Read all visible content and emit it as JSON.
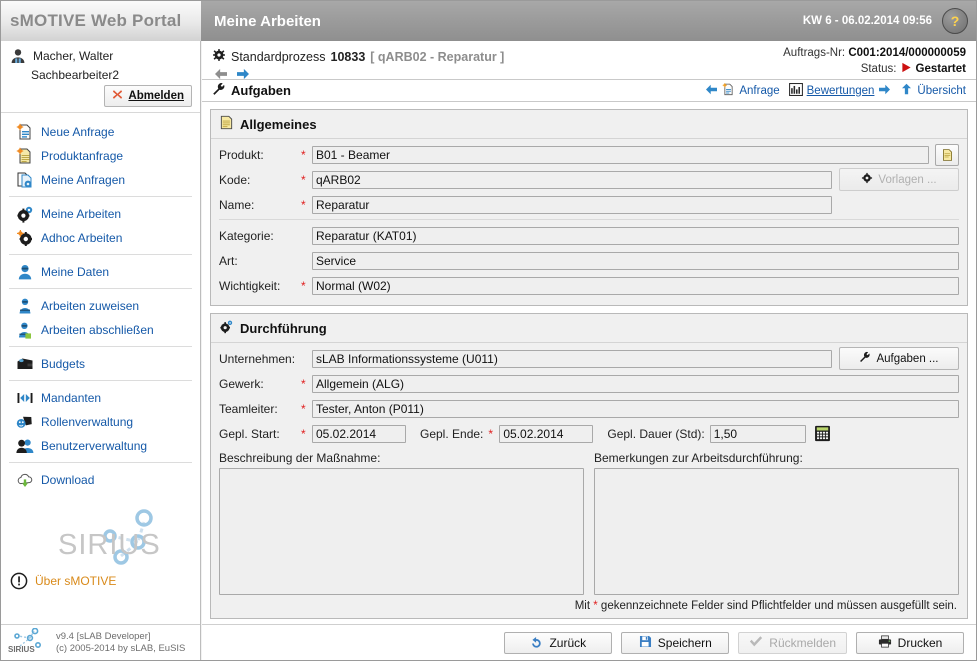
{
  "app": {
    "brand": "sMOTIVE Web Portal",
    "page_title": "Meine Arbeiten",
    "kw_datetime": "KW 6 - 06.02.2014 09:56",
    "help_label": "?"
  },
  "user": {
    "name": "Macher, Walter",
    "role": "Sachbearbeiter2",
    "logout_label": "Abmelden"
  },
  "sidebar": {
    "groups": [
      {
        "items": [
          {
            "label": "Neue Anfrage",
            "icon": "new-request-icon"
          },
          {
            "label": "Produktanfrage",
            "icon": "product-request-icon"
          },
          {
            "label": "Meine Anfragen",
            "icon": "my-requests-icon"
          }
        ]
      },
      {
        "items": [
          {
            "label": "Meine Arbeiten",
            "icon": "my-works-icon"
          },
          {
            "label": "Adhoc Arbeiten",
            "icon": "adhoc-works-icon"
          }
        ]
      },
      {
        "items": [
          {
            "label": "Meine Daten",
            "icon": "my-data-icon"
          }
        ]
      },
      {
        "items": [
          {
            "label": "Arbeiten zuweisen",
            "icon": "assign-works-icon"
          },
          {
            "label": "Arbeiten abschließen",
            "icon": "complete-works-icon"
          }
        ]
      },
      {
        "items": [
          {
            "label": "Budgets",
            "icon": "budgets-icon"
          }
        ]
      },
      {
        "items": [
          {
            "label": "Mandanten",
            "icon": "clients-icon"
          },
          {
            "label": "Rollenverwaltung",
            "icon": "roles-icon"
          },
          {
            "label": "Benutzerverwaltung",
            "icon": "users-icon"
          }
        ]
      },
      {
        "items": [
          {
            "label": "Download",
            "icon": "download-icon"
          }
        ]
      }
    ],
    "logo_text": "SIRIUS",
    "about_label": "Über sMOTIVE",
    "footer_line1": "v9.4 [sLAB Developer]",
    "footer_line2": "(c) 2005-2014 by sLAB, EuSIS",
    "footer_logo_text": "SIRIUS"
  },
  "breadcrumb": {
    "process_label": "Standardprozess",
    "process_number": "10833",
    "process_detail": "[ qARB02 - Reparatur ]"
  },
  "order": {
    "number_label": "Auftrags-Nr:",
    "number_value": "C001:2014/000000059",
    "status_label": "Status:",
    "status_value": "Gestartet"
  },
  "tasks": {
    "title": "Aufgaben",
    "links": [
      {
        "label": "Anfrage",
        "icon": "request-icon"
      },
      {
        "label": "Bewertungen",
        "icon": "ratings-icon"
      },
      {
        "label": "Übersicht",
        "icon": "overview-icon"
      }
    ]
  },
  "general": {
    "title": "Allgemeines",
    "fields": [
      {
        "label": "Produkt:",
        "required": true,
        "value": "B01 - Beamer"
      },
      {
        "label": "Kode:",
        "required": true,
        "value": "qARB02"
      },
      {
        "label": "Name:",
        "required": true,
        "value": "Reparatur"
      },
      {
        "label": "Kategorie:",
        "required": false,
        "value": "Reparatur (KAT01)"
      },
      {
        "label": "Art:",
        "required": false,
        "value": "Service"
      },
      {
        "label": "Wichtigkeit:",
        "required": true,
        "value": "Normal (W02)"
      }
    ],
    "doc_button_name": "document-button",
    "templates_button": "Vorlagen ..."
  },
  "execution": {
    "title": "Durchführung",
    "fields": [
      {
        "label": "Unternehmen:",
        "required": false,
        "value": "sLAB Informationssysteme (U011)"
      },
      {
        "label": "Gewerk:",
        "required": true,
        "value": "Allgemein (ALG)"
      },
      {
        "label": "Teamleiter:",
        "required": true,
        "value": "Tester, Anton (P011)"
      }
    ],
    "tasks_button": "Aufgaben ...",
    "start_label": "Gepl. Start:",
    "start_value": "05.02.2014",
    "end_label": "Gepl. Ende:",
    "end_value": "05.02.2014",
    "duration_label": "Gepl. Dauer (Std):",
    "duration_value": "1,50",
    "description_label": "Beschreibung der Maßnahme:",
    "description_value": "",
    "remarks_label": "Bemerkungen zur Arbeitsdurchführung:",
    "remarks_value": "",
    "required_hint_prefix": "Mit",
    "required_hint_star": "*",
    "required_hint_suffix": "gekennzeichnete Felder sind Pflichtfelder und müssen ausgefüllt sein."
  },
  "footer_buttons": [
    {
      "label": "Zurück",
      "icon": "back-icon",
      "disabled": false
    },
    {
      "label": "Speichern",
      "icon": "save-icon",
      "disabled": false
    },
    {
      "label": "Rückmelden",
      "icon": "check-icon",
      "disabled": true
    },
    {
      "label": "Drucken",
      "icon": "print-icon",
      "disabled": false
    }
  ],
  "colors": {
    "link": "#1559a8",
    "required": "#e02020",
    "accent_orange": "#d98a1a",
    "header_gray": "#9b9b9b"
  }
}
